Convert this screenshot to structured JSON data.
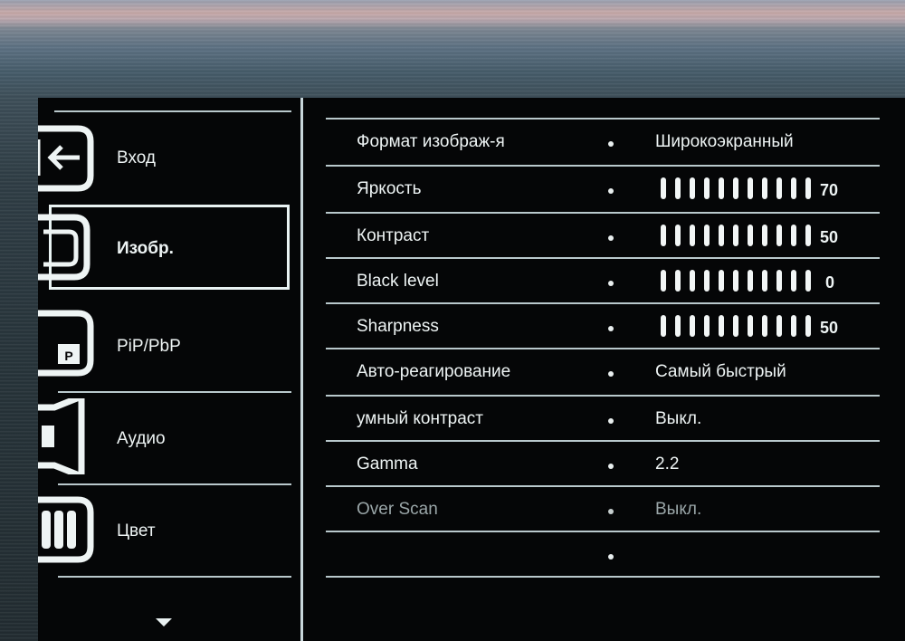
{
  "sidebar": {
    "items": [
      {
        "label": "Вход",
        "icon": "input-icon"
      },
      {
        "label": "Изобр.",
        "icon": "picture-icon",
        "selected": true
      },
      {
        "label": "PiP/PbP",
        "icon": "pip-icon"
      },
      {
        "label": "Аудио",
        "icon": "speaker-icon"
      },
      {
        "label": "Цвет",
        "icon": "color-icon"
      }
    ],
    "more_icon": "chevron-down-icon"
  },
  "settings": [
    {
      "name": "Формат изображ-я",
      "value": "Широкоэкранный"
    },
    {
      "name": "Яркость",
      "level": 70,
      "level_text": "70"
    },
    {
      "name": "Контраст",
      "level": 50,
      "level_text": "50"
    },
    {
      "name": "Black level",
      "level": 0,
      "level_text": "0"
    },
    {
      "name": "Sharpness",
      "level": 50,
      "level_text": "50"
    },
    {
      "name": "Авто-реагирование",
      "value": "Самый быстрый"
    },
    {
      "name": "умный контраст",
      "value": "Выкл."
    },
    {
      "name": "Gamma",
      "value": "2.2"
    },
    {
      "name": "Over Scan",
      "value": "Выкл.",
      "disabled": true
    },
    {
      "name": "",
      "value": ""
    }
  ]
}
